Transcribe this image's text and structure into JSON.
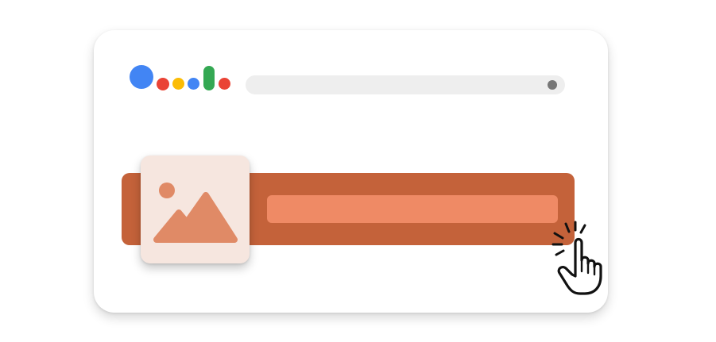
{
  "colors": {
    "card_background": "#ffffff",
    "logo_blue": "#4285f4",
    "logo_red": "#ea4335",
    "logo_yellow": "#fbbc05",
    "logo_green": "#34a853",
    "search_bar": "#eeeeee",
    "search_dot": "#777777",
    "result_bar": "#c4623a",
    "result_inner": "#ef8a65",
    "thumbnail_background": "#f6e6df",
    "thumbnail_glyph": "#e08a66"
  },
  "icons": {
    "logo": "google-assistant-dots-icon",
    "thumbnail": "image-placeholder-icon",
    "cursor": "hand-pointer-click-icon"
  }
}
